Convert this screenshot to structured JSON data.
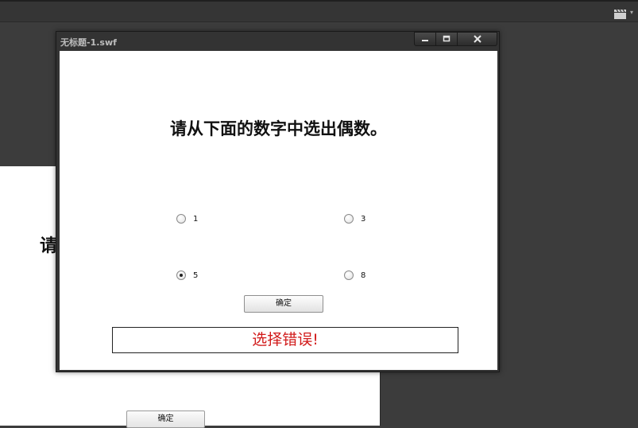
{
  "window": {
    "title": "无标题-1.swf",
    "buttons": [
      "minimize-icon",
      "maximize-icon",
      "close-icon"
    ]
  },
  "quiz": {
    "question": "请从下面的数字中选出偶数。",
    "options": [
      {
        "label": "1",
        "selected": false
      },
      {
        "label": "3",
        "selected": false
      },
      {
        "label": "5",
        "selected": true
      },
      {
        "label": "8",
        "selected": false
      }
    ],
    "confirm_label": "确定",
    "feedback": "选择错误!",
    "feedback_color": "#d11a1a"
  },
  "background_stage": {
    "question_partial": "请",
    "confirm_label": "确定"
  },
  "toolbar": {
    "icon": "clapperboard-icon"
  }
}
